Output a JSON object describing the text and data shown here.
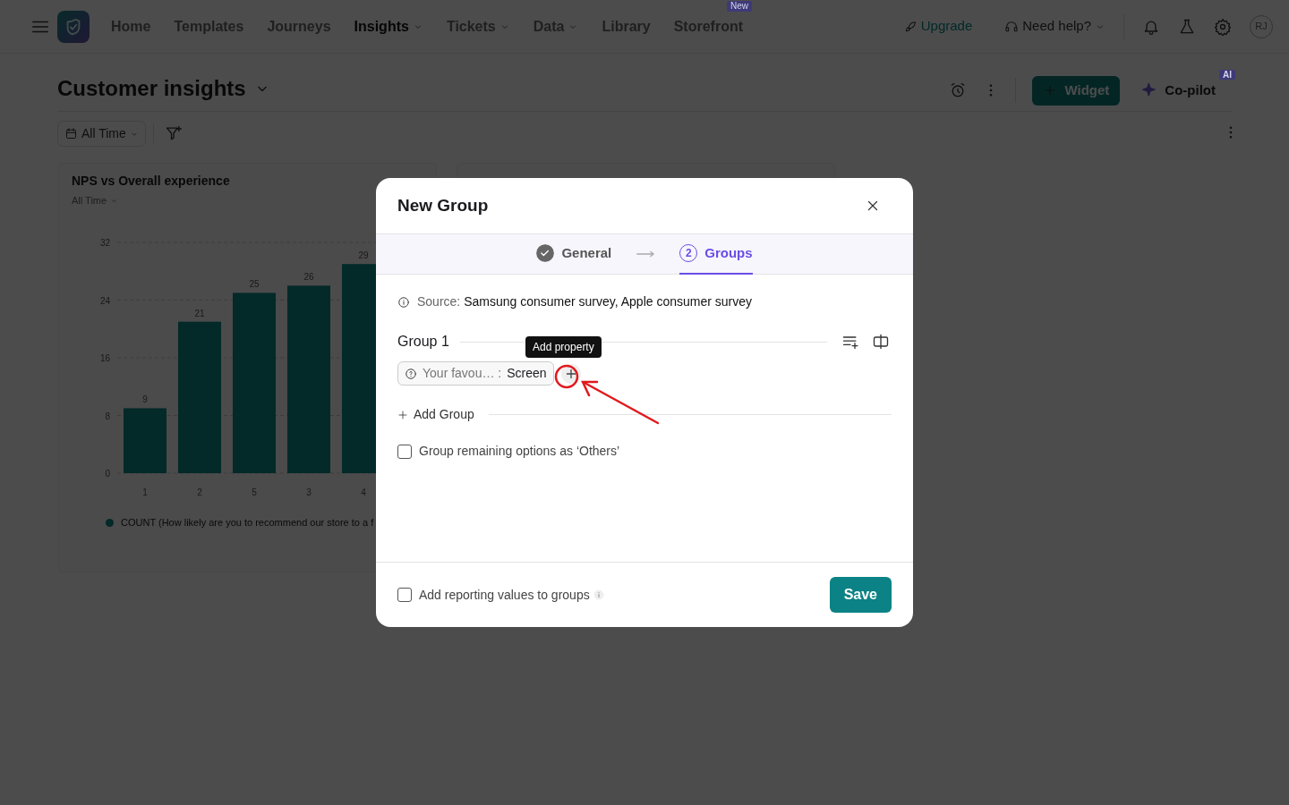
{
  "nav": {
    "items": [
      {
        "label": "Home",
        "selected": false,
        "dropdown": false
      },
      {
        "label": "Templates",
        "selected": false,
        "dropdown": false
      },
      {
        "label": "Journeys",
        "selected": false,
        "dropdown": false
      },
      {
        "label": "Insights",
        "selected": true,
        "dropdown": true
      },
      {
        "label": "Tickets",
        "selected": false,
        "dropdown": true
      },
      {
        "label": "Data",
        "selected": false,
        "dropdown": true
      },
      {
        "label": "Library",
        "selected": false,
        "dropdown": false
      },
      {
        "label": "Storefront",
        "selected": false,
        "dropdown": false,
        "badge": "New"
      }
    ],
    "upgrade": "Upgrade",
    "help": "Need help?",
    "avatar": "RJ"
  },
  "page": {
    "title": "Customer insights",
    "widget_button": "Widget",
    "copilot": "Co-pilot",
    "copilot_badge": "AI",
    "filter": "All Time"
  },
  "cards": [
    {
      "title": "NPS vs Overall experience",
      "period": "All Time",
      "chart_data": {
        "type": "bar",
        "categories": [
          "1",
          "2",
          "5",
          "3",
          "4"
        ],
        "series": [
          {
            "name": "COUNT (How likely are you to recommend our store to a f",
            "color": "#0b8a88",
            "values": [
              9,
              21,
              25,
              26,
              29
            ]
          }
        ],
        "ylim": [
          0,
          32
        ],
        "yticks": [
          0,
          8,
          16,
          24,
          32
        ],
        "grid": true,
        "data_labels": true
      }
    }
  ],
  "modal": {
    "title": "New Group",
    "steps": [
      {
        "label": "General",
        "done": true,
        "selected": false
      },
      {
        "label": "Groups",
        "number": "2",
        "done": false,
        "selected": true
      }
    ],
    "source_label": "Source:",
    "source": "Samsung consumer survey, Apple consumer survey",
    "groups": [
      {
        "name": "Group 1",
        "properties": [
          {
            "name": "Your favou…",
            "separator": ":",
            "value": "Screen"
          }
        ]
      }
    ],
    "tooltip": "Add property",
    "add_group": "Add Group",
    "options": [
      {
        "label": "Group remaining options as ‘Others’",
        "checked": false
      }
    ],
    "footer_option": {
      "label": "Add reporting values to groups",
      "checked": false
    },
    "save": "Save"
  }
}
